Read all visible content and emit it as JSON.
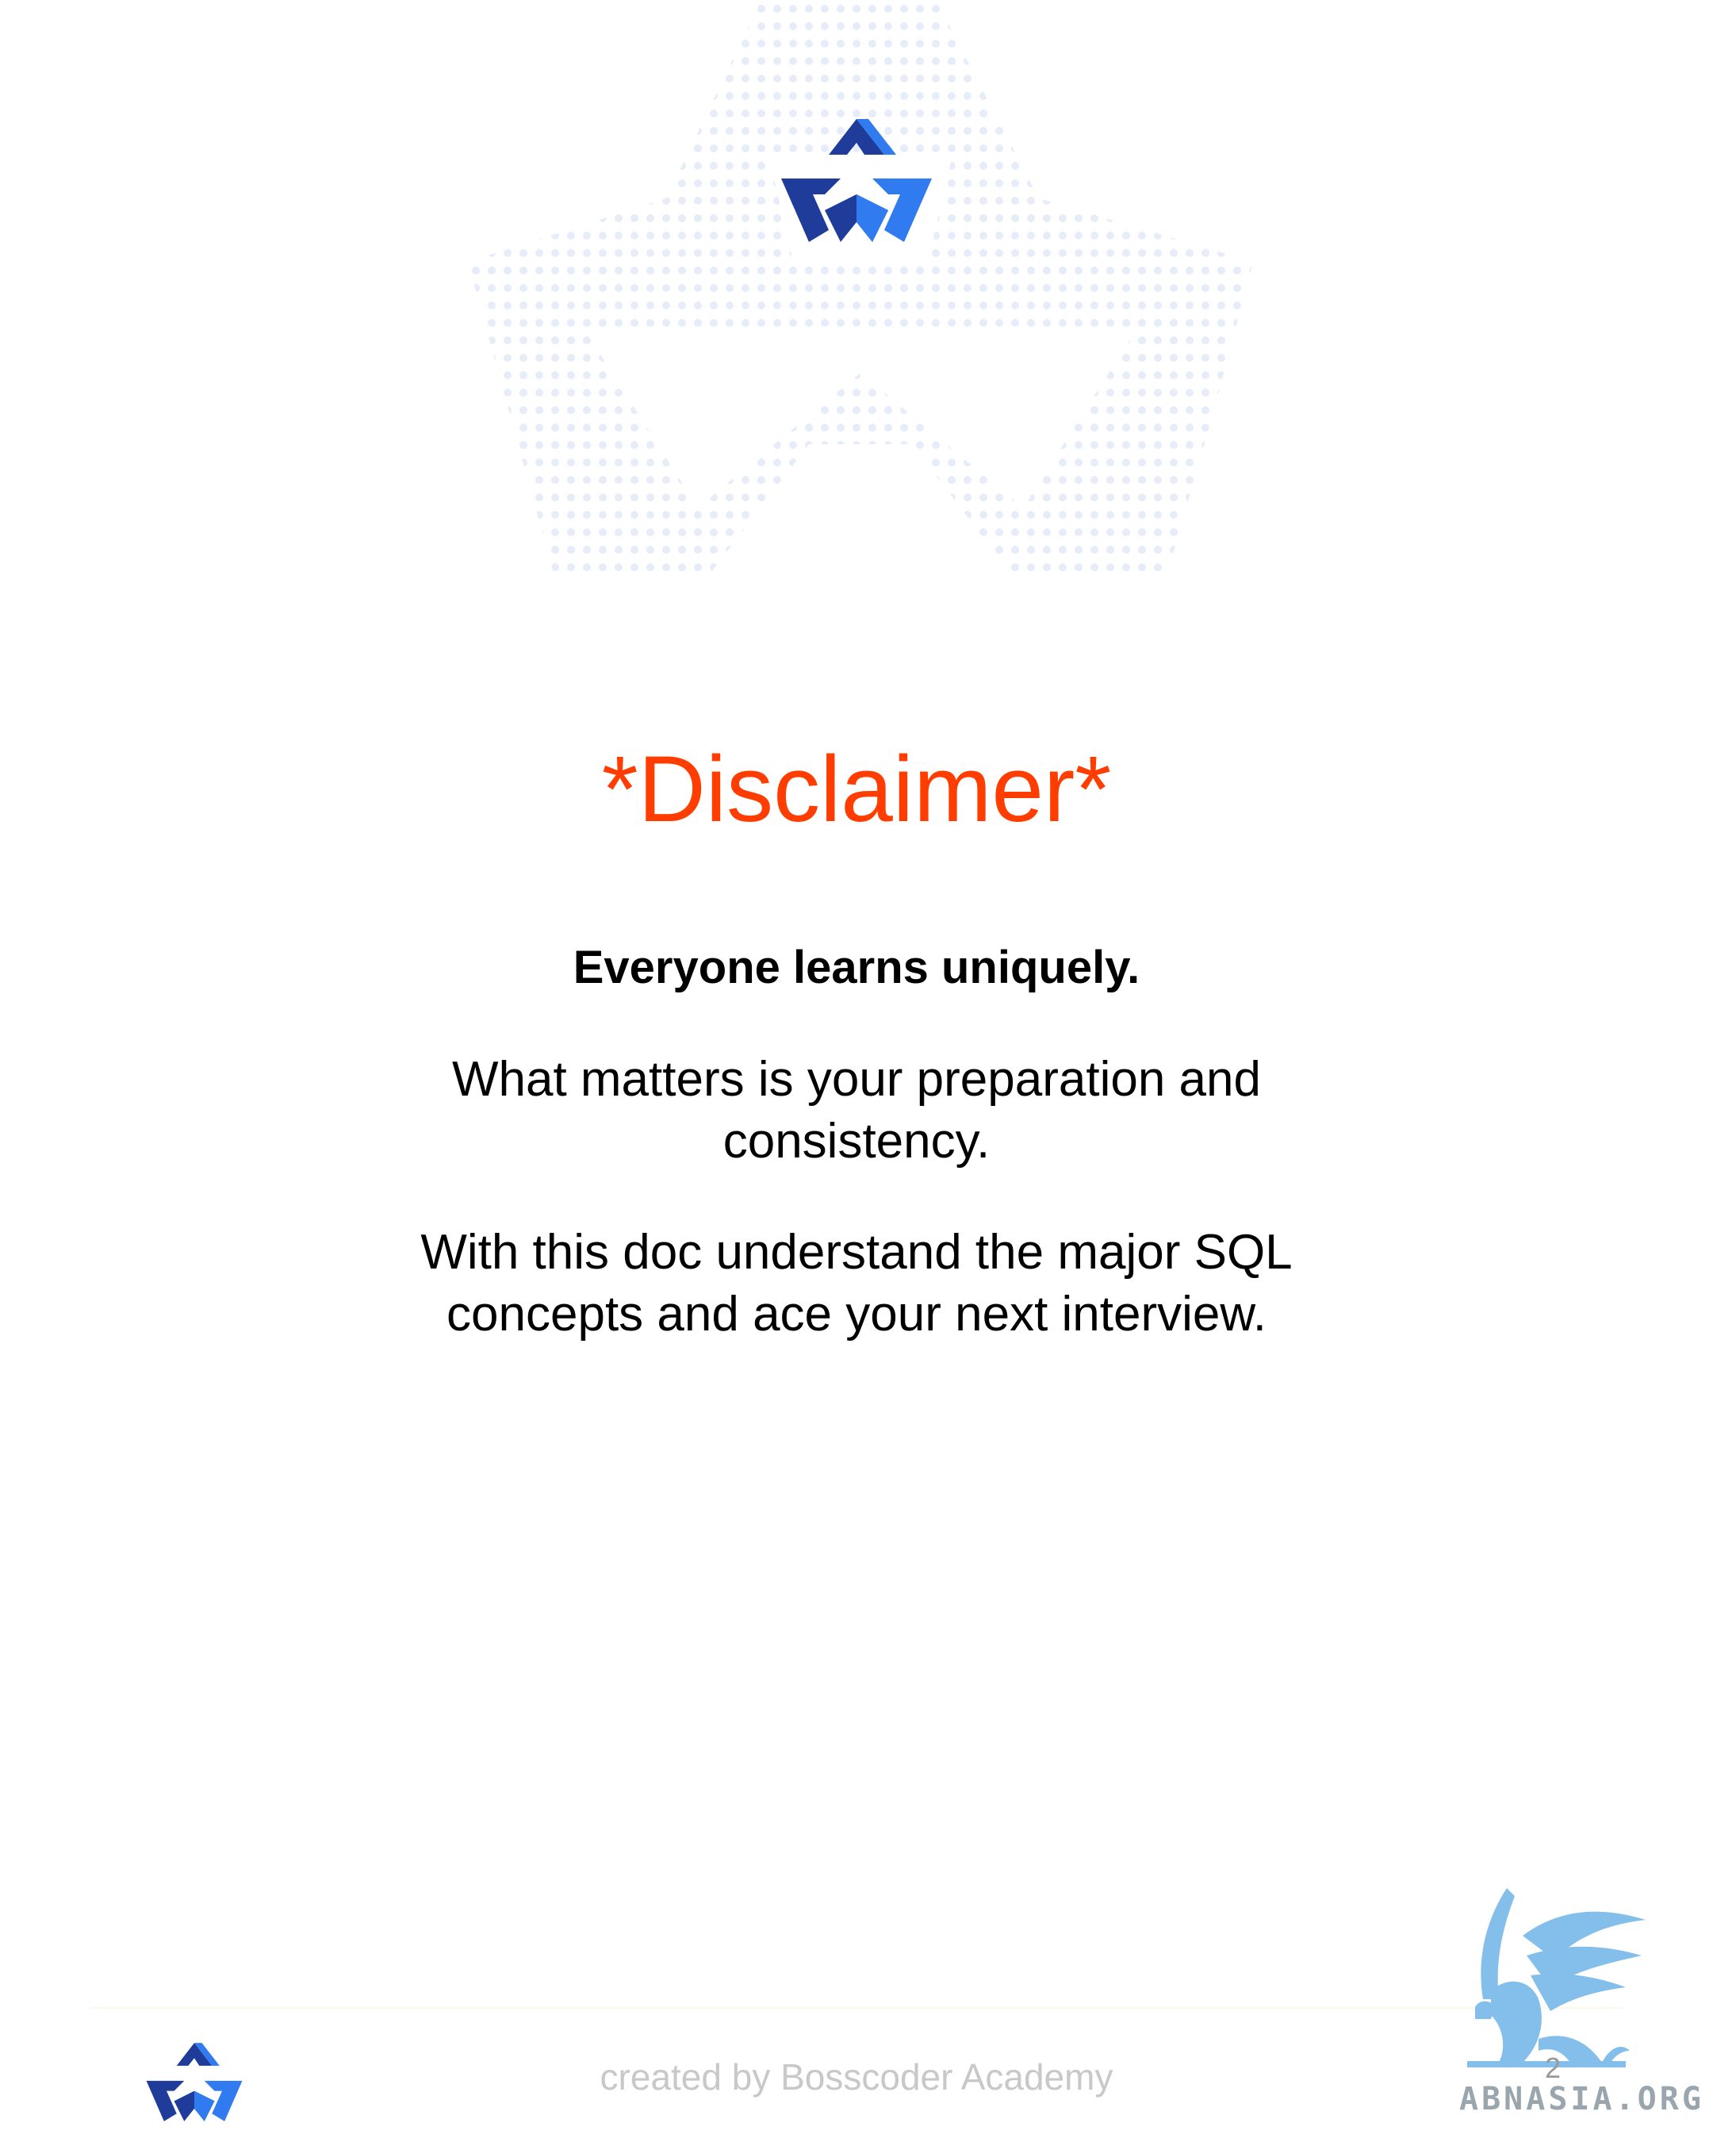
{
  "document": {
    "title": "*Disclaimer*",
    "subtitle": "Everyone learns uniquely.",
    "paragraphs": [
      "What matters is your preparation and consistency.",
      "With this doc understand the major SQL concepts and ace your next interview."
    ]
  },
  "footer": {
    "credit": "created by Bosscoder Academy",
    "page_number": "2"
  },
  "stamp": {
    "text": "ABNASIA.ORG"
  },
  "icons": {
    "brand_logo": "bosscoder-logo-icon",
    "watermark": "dotted-logo-watermark",
    "stamp_mascot": "griffin-mascot-icon"
  },
  "colors": {
    "title": "#FF3D00",
    "logo_dark": "#1F3C9B",
    "logo_light": "#2F7BEF",
    "watermark_dots": "#E6ECF8",
    "credit_text": "#C8C8C8",
    "stamp": "#6FB4E8"
  }
}
